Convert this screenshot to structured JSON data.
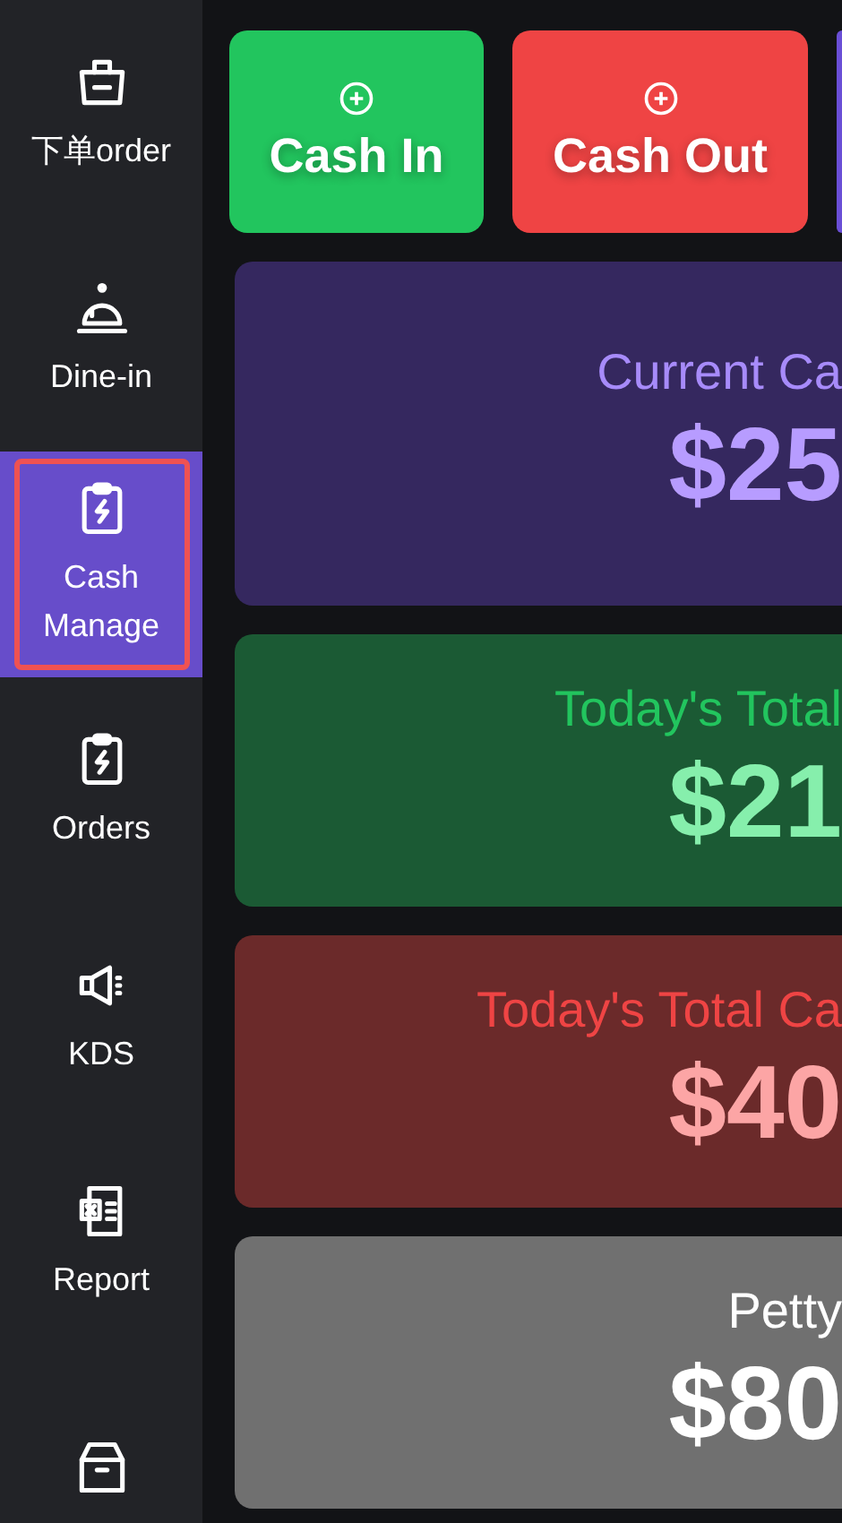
{
  "sidebar": {
    "items": [
      {
        "kind": "basket",
        "label": "下单order",
        "selected": false,
        "focused": false
      },
      {
        "kind": "bell",
        "label": "Dine-in",
        "selected": false,
        "focused": false
      },
      {
        "kind": "clipboard",
        "label": "Cash Manage",
        "selected": true,
        "focused": true
      },
      {
        "kind": "clipboard",
        "label": "Orders",
        "selected": false,
        "focused": false
      },
      {
        "kind": "speaker",
        "label": "KDS",
        "selected": false,
        "focused": false
      },
      {
        "kind": "sheet",
        "label": "Report",
        "selected": false,
        "focused": false
      },
      {
        "kind": "archive",
        "selected": false,
        "focused": false
      }
    ]
  },
  "actions": [
    {
      "kind": "in",
      "label": "Cash In"
    },
    {
      "kind": "out",
      "label": "Cash Out"
    },
    {
      "kind": "other"
    }
  ],
  "cards": [
    {
      "kind": "purple",
      "label": "Current Ca",
      "value": "$25"
    },
    {
      "kind": "green",
      "label": "Today's Total",
      "value": "$21"
    },
    {
      "kind": "red",
      "label": "Today's Total Ca",
      "value": "$40"
    },
    {
      "kind": "gray",
      "label": "Petty",
      "value": "$80"
    }
  ]
}
